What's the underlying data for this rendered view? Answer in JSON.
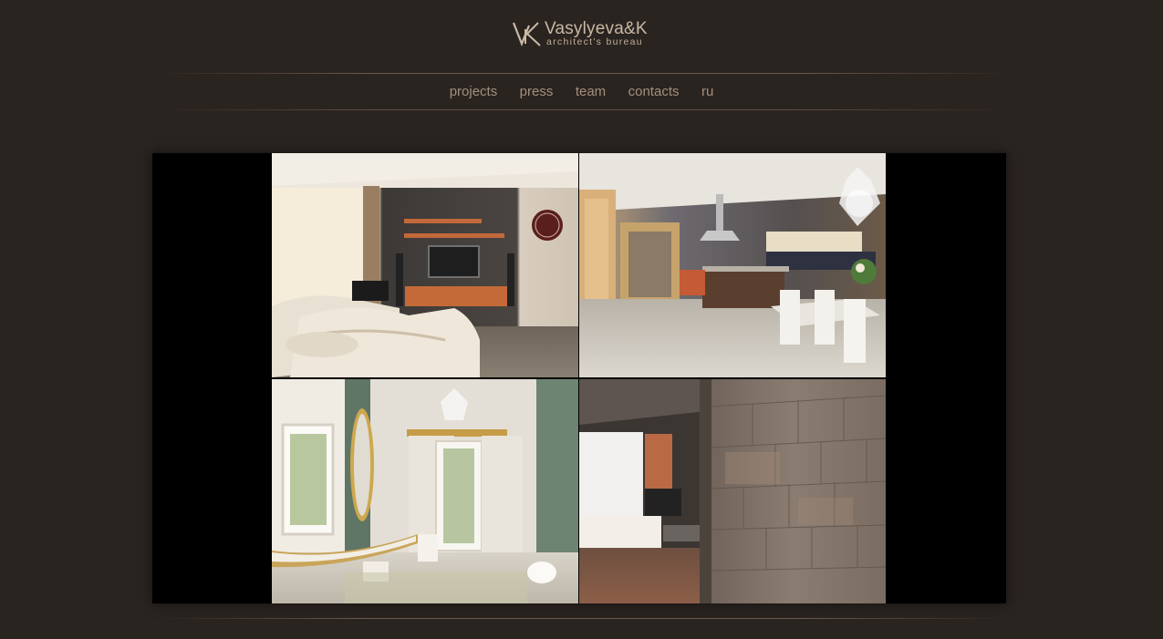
{
  "header": {
    "logo_mark": "VK",
    "brand_name": "Vasylyeva&K",
    "tagline": "architect's bureau"
  },
  "nav": {
    "items": [
      {
        "label": "projects"
      },
      {
        "label": "press"
      },
      {
        "label": "team"
      },
      {
        "label": "contacts"
      },
      {
        "label": "ru"
      }
    ]
  },
  "gallery": {
    "tiles": [
      {
        "subject": "living-room"
      },
      {
        "subject": "kitchen-dining"
      },
      {
        "subject": "bathroom"
      },
      {
        "subject": "living-room-stone-wall"
      }
    ]
  },
  "colors": {
    "background": "#2a2420",
    "nav_text": "#a48f7a",
    "logo_text": "#c9b8a3",
    "gallery_frame": "#000000"
  }
}
